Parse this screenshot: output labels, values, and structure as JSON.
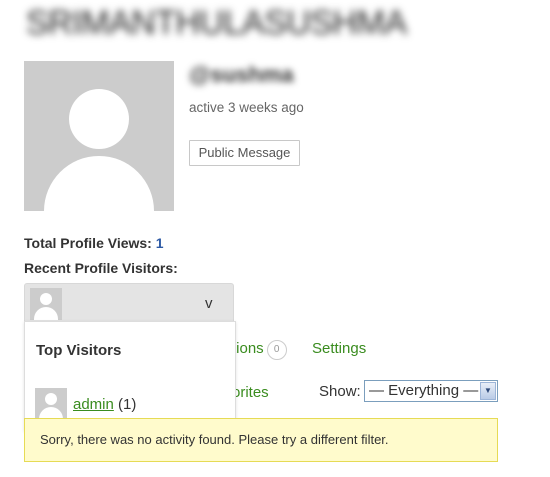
{
  "profile": {
    "display_name": "SRIMANTHULASUSHMA",
    "handle": "@sushma",
    "activity": "active 3 weeks ago",
    "public_message_label": "Public Message"
  },
  "stats": {
    "total_views_label": "Total Profile Views:",
    "total_views_count": "1",
    "recent_visitors_label": "Recent Profile Visitors:"
  },
  "visitors_dropdown": {
    "toggle_icon": "chevron-down-icon",
    "toggle_glyph": "v",
    "title": "Top Visitors",
    "items": [
      {
        "name": "admin",
        "count": "(1)"
      }
    ]
  },
  "nav": {
    "notifications_label": "tions",
    "notifications_badge": "0",
    "settings_label": "Settings",
    "favorites_label": "orites"
  },
  "filter": {
    "label": "Show:",
    "selected": "— Everything —",
    "arrow_glyph": "▼"
  },
  "notice": {
    "text": "Sorry, there was no activity found. Please try a different filter."
  },
  "colors": {
    "link_green": "#3a8c1f",
    "count_blue": "#2e5aa5",
    "notice_bg": "#fffbcc",
    "notice_border": "#e6db55"
  }
}
